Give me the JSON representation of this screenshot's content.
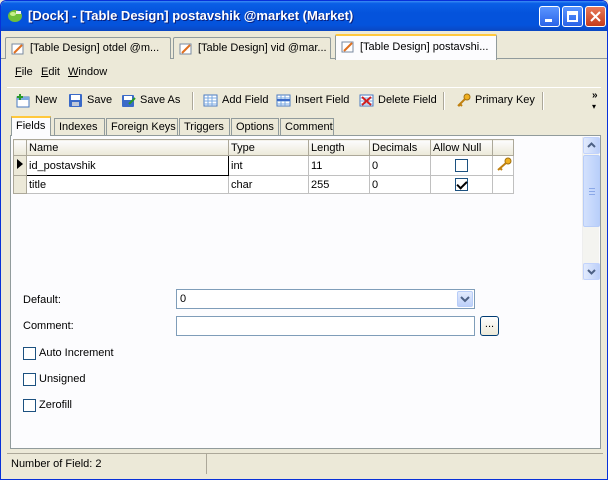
{
  "window": {
    "title": "[Dock] - [Table Design] postavshik @market (Market)"
  },
  "doc_tabs": [
    {
      "label": "[Table Design] otdel @m...",
      "active": false
    },
    {
      "label": "[Table Design] vid @mar...",
      "active": false
    },
    {
      "label": "[Table Design] postavshi...",
      "active": true
    }
  ],
  "menu": {
    "file": "File",
    "edit": "Edit",
    "window": "Window"
  },
  "toolbar": {
    "new": "New",
    "save": "Save",
    "save_as": "Save As",
    "add_field": "Add Field",
    "insert_field": "Insert Field",
    "delete_field": "Delete Field",
    "primary_key": "Primary Key",
    "overflow": "»"
  },
  "inner_tabs": [
    {
      "label": "Fields",
      "active": true
    },
    {
      "label": "Indexes",
      "active": false
    },
    {
      "label": "Foreign Keys",
      "active": false
    },
    {
      "label": "Triggers",
      "active": false
    },
    {
      "label": "Options",
      "active": false
    },
    {
      "label": "Comment",
      "active": false
    }
  ],
  "grid": {
    "columns": [
      "Name",
      "Type",
      "Length",
      "Decimals",
      "Allow Null"
    ],
    "rows": [
      {
        "name": "id_postavshik",
        "type": "int",
        "length": "11",
        "decimals": "0",
        "allow_null": false,
        "primary_key": true,
        "selected": true
      },
      {
        "name": "title",
        "type": "char",
        "length": "255",
        "decimals": "0",
        "allow_null": true,
        "primary_key": false,
        "selected": false
      }
    ]
  },
  "properties": {
    "default_label": "Default:",
    "default_value": "0",
    "comment_label": "Comment:",
    "comment_value": "",
    "ellipsis": "...",
    "auto_increment": {
      "label": "Auto Increment",
      "checked": false
    },
    "unsigned": {
      "label": "Unsigned",
      "checked": false
    },
    "zerofill": {
      "label": "Zerofill",
      "checked": false
    }
  },
  "status": {
    "field_count": "Number of Field: 2"
  },
  "colors": {
    "titlebar": "#0453dc",
    "active_tab_accent": "#ffc83c",
    "window_bg": "#ece9d8"
  }
}
